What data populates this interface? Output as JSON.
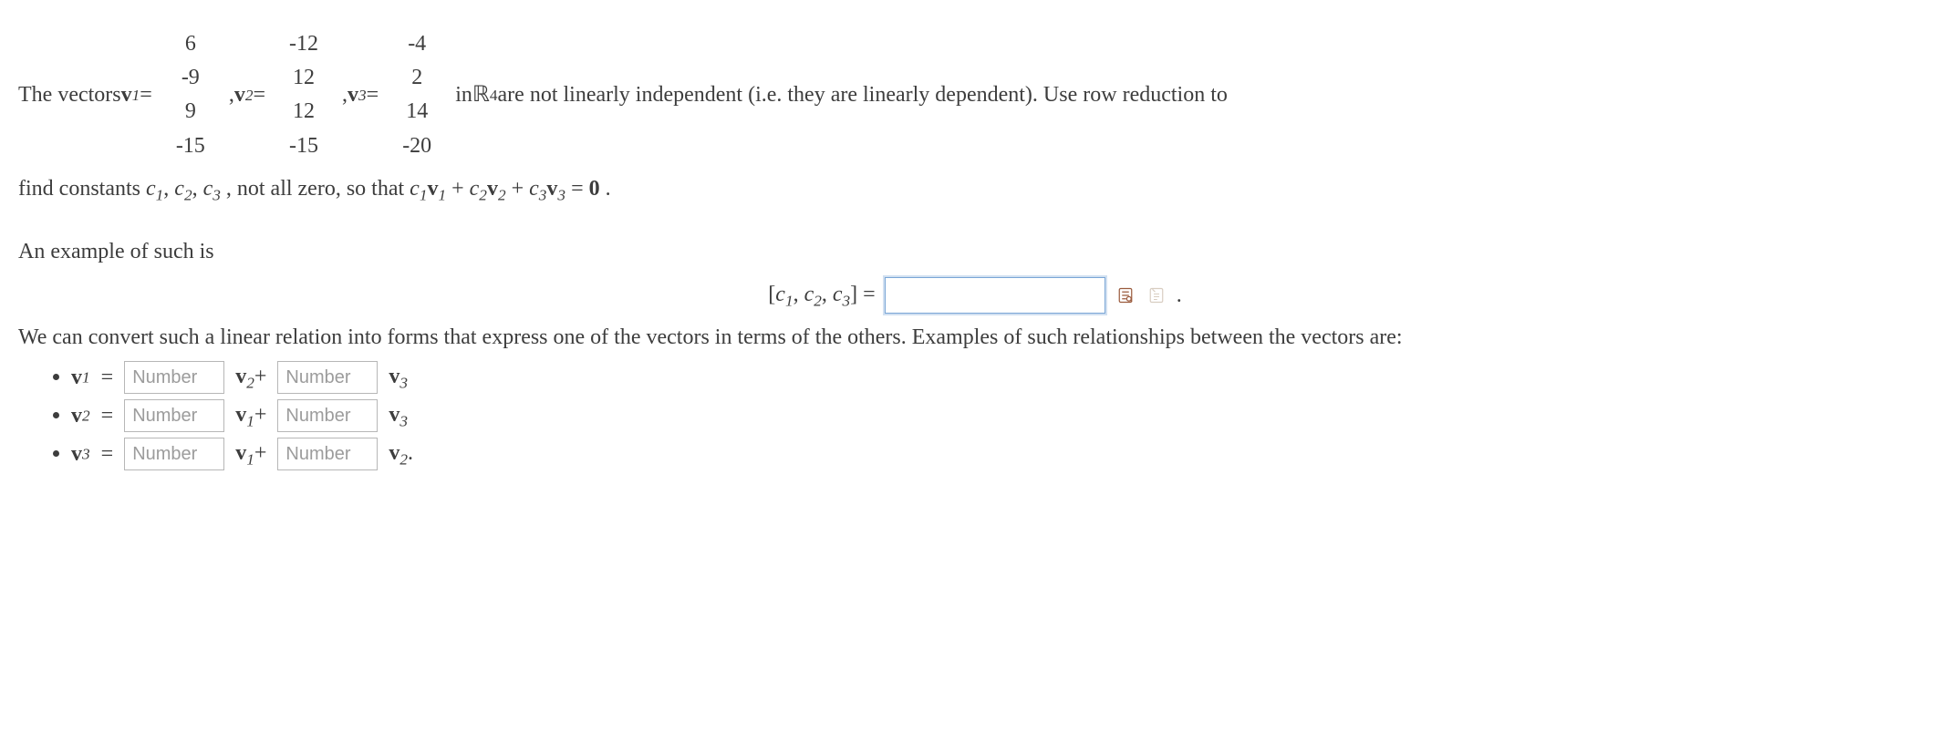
{
  "intro": {
    "lead": "The vectors ",
    "v_label": "v",
    "eq": " = ",
    "comma": ", ",
    "in_text": " in ",
    "R_symbol": "ℝ",
    "R_power": "4",
    "tail": " are not linearly independent (i.e. they are linearly dependent). Use row reduction to"
  },
  "intro2": {
    "lead": "find constants ",
    "c": "c",
    "mid": " , not all zero, so that ",
    "plus": " + ",
    "eq0": " = ",
    "zero": "0",
    "period": " ."
  },
  "vectors": {
    "v1": [
      "6",
      "-9",
      "9",
      "-15"
    ],
    "v2": [
      "-12",
      "12",
      "12",
      "-15"
    ],
    "v3": [
      "-4",
      "2",
      "14",
      "-20"
    ]
  },
  "example_label": "An example of such is",
  "answer": {
    "lhs_open": "[",
    "c": "c",
    "sep": ", ",
    "lhs_close": "] = ",
    "value": "",
    "period": "."
  },
  "convert_text": "We can convert such a linear relation into forms that express one of the vectors in terms of the others. Examples of such relationships between the vectors are:",
  "placeholder": "Number",
  "rel": {
    "v": "v",
    "eq": " = ",
    "plus": "+ ",
    "period": "."
  }
}
